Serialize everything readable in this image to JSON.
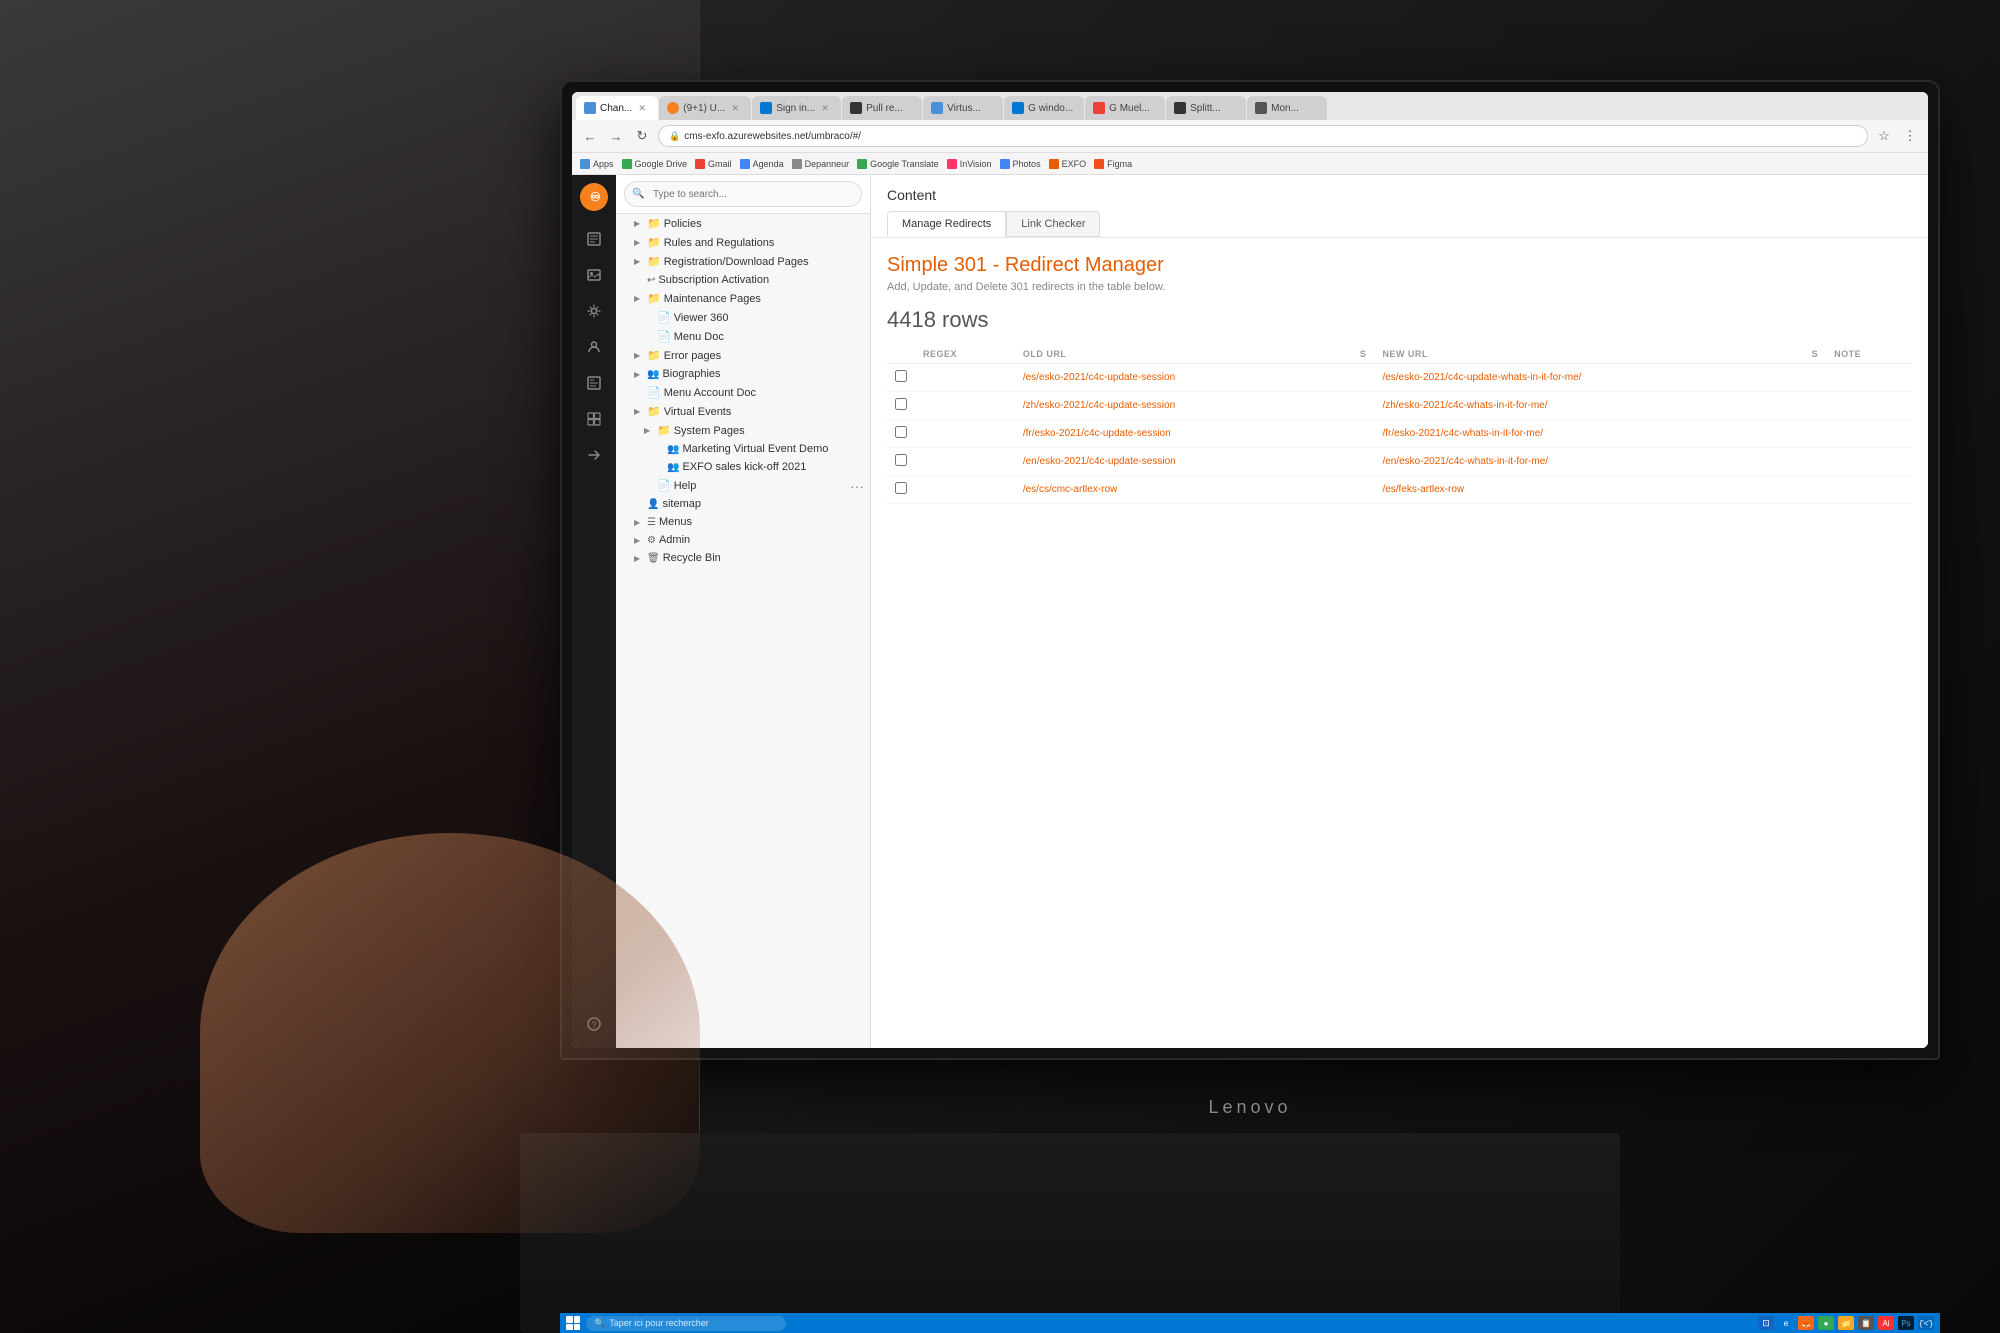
{
  "background": {
    "color": "#1a1a1a"
  },
  "laptop": {
    "brand": "Lenovo"
  },
  "browser": {
    "url": "cms-exfo.azurewebsites.net/umbraco/#/",
    "tabs": [
      {
        "id": 1,
        "label": "Chan...",
        "active": true,
        "favicon_color": "#4a90d9"
      },
      {
        "id": 2,
        "label": "(9+1) U...",
        "active": false,
        "favicon_color": "#f5821f"
      },
      {
        "id": 3,
        "label": "Sign in...",
        "active": false,
        "favicon_color": "#0078d4"
      },
      {
        "id": 4,
        "label": "Pull re...",
        "active": false,
        "favicon_color": "#333"
      },
      {
        "id": 5,
        "label": "Virtus...",
        "active": false,
        "favicon_color": "#4a90d9"
      },
      {
        "id": 6,
        "label": "windo...",
        "active": false,
        "favicon_color": "#0078d4"
      },
      {
        "id": 7,
        "label": "G Muel...",
        "active": false,
        "favicon_color": "#e44"
      },
      {
        "id": 8,
        "label": "Splitt...",
        "active": false,
        "favicon_color": "#333"
      }
    ],
    "bookmarks": [
      {
        "label": "Apps",
        "favicon_color": "#4a90d9"
      },
      {
        "label": "Google Drive",
        "favicon_color": "#34a853"
      },
      {
        "label": "Gmail",
        "favicon_color": "#ea4335"
      },
      {
        "label": "Agenda",
        "favicon_color": "#4285f4"
      },
      {
        "label": "Depanneur",
        "favicon_color": "#888"
      },
      {
        "label": "Google Translate",
        "favicon_color": "#34a853"
      },
      {
        "label": "InVision",
        "favicon_color": "#ff3366"
      },
      {
        "label": "Photos",
        "favicon_color": "#4285f4"
      },
      {
        "label": "EXFO",
        "favicon_color": "#e65c00"
      },
      {
        "label": "Figma",
        "favicon_color": "#f24e1e"
      }
    ]
  },
  "umbraco": {
    "sidebar_icons": [
      {
        "name": "content-icon",
        "symbol": "📄"
      },
      {
        "name": "media-icon",
        "symbol": "🖼"
      },
      {
        "name": "settings-icon",
        "symbol": "⚙"
      },
      {
        "name": "users-icon",
        "symbol": "👤"
      },
      {
        "name": "forms-icon",
        "symbol": "☰"
      },
      {
        "name": "packages-icon",
        "symbol": "▦"
      },
      {
        "name": "deploy-icon",
        "symbol": "→"
      },
      {
        "name": "help-icon",
        "symbol": "?"
      }
    ]
  },
  "tree": {
    "search_placeholder": "Type to search...",
    "items": [
      {
        "id": "policies",
        "label": "Policies",
        "indent": 1,
        "has_toggle": true,
        "icon": "📁"
      },
      {
        "id": "rules",
        "label": "Rules and Regulations",
        "indent": 1,
        "has_toggle": true,
        "icon": "📁"
      },
      {
        "id": "registration",
        "label": "Registration/Download Pages",
        "indent": 1,
        "has_toggle": true,
        "icon": "📁"
      },
      {
        "id": "subscription",
        "label": "Subscription Activation",
        "indent": 1,
        "has_toggle": false,
        "icon": "↩"
      },
      {
        "id": "maintenance",
        "label": "Maintenance Pages",
        "indent": 1,
        "has_toggle": true,
        "icon": "📁"
      },
      {
        "id": "viewer360",
        "label": "Viewer 360",
        "indent": 2,
        "has_toggle": false,
        "icon": "📄"
      },
      {
        "id": "menudoc",
        "label": "Menu Doc",
        "indent": 2,
        "has_toggle": false,
        "icon": "📄"
      },
      {
        "id": "errorpages",
        "label": "Error pages",
        "indent": 1,
        "has_toggle": true,
        "icon": "📁"
      },
      {
        "id": "biographies",
        "label": "Biographies",
        "indent": 1,
        "has_toggle": true,
        "icon": "👥"
      },
      {
        "id": "menuaccountdoc",
        "label": "Menu Account Doc",
        "indent": 1,
        "has_toggle": false,
        "icon": "📄"
      },
      {
        "id": "virtualevents",
        "label": "Virtual Events",
        "indent": 1,
        "has_toggle": true,
        "icon": "📁"
      },
      {
        "id": "systempages",
        "label": "System Pages",
        "indent": 2,
        "has_toggle": true,
        "icon": "📁"
      },
      {
        "id": "marketingvirtual",
        "label": "Marketing Virtual Event Demo",
        "indent": 3,
        "has_toggle": false,
        "icon": "👥"
      },
      {
        "id": "exfosales",
        "label": "EXFO sales kick-off 2021",
        "indent": 3,
        "has_toggle": false,
        "icon": "👥"
      },
      {
        "id": "help",
        "label": "Help",
        "indent": 2,
        "has_toggle": false,
        "icon": "📄"
      },
      {
        "id": "sitemap",
        "label": "sitemap",
        "indent": 1,
        "has_toggle": false,
        "icon": "👤",
        "has_more": true
      },
      {
        "id": "menus",
        "label": "Menus",
        "indent": 1,
        "has_toggle": true,
        "icon": "☰"
      },
      {
        "id": "admin",
        "label": "Admin",
        "indent": 1,
        "has_toggle": true,
        "icon": "⚙"
      },
      {
        "id": "recycle",
        "label": "Recycle Bin",
        "indent": 1,
        "has_toggle": true,
        "icon": "🗑"
      }
    ]
  },
  "content": {
    "title": "Content",
    "tabs": [
      {
        "id": "manage-redirects",
        "label": "Manage Redirects",
        "active": true
      },
      {
        "id": "link-checker",
        "label": "Link Checker",
        "active": false
      }
    ],
    "redirect_manager": {
      "title": "Simple 301 - Redirect Manager",
      "subtitle": "Add, Update, and Delete 301 redirects in the table below.",
      "rows_count": "4418 rows",
      "table_headers": [
        {
          "id": "regex",
          "label": "REGEX"
        },
        {
          "id": "old_url",
          "label": "OLD URL"
        },
        {
          "id": "s1",
          "label": "S"
        },
        {
          "id": "new_url",
          "label": "NEW URL"
        },
        {
          "id": "s2",
          "label": "S"
        },
        {
          "id": "notes",
          "label": "NOTE"
        }
      ],
      "rows": [
        {
          "checkbox": false,
          "old_url": "/es/esko-2021/c4c-update-session",
          "new_url": "/es/esko-2021/c4c-update-whats-in-it-for-me/"
        },
        {
          "checkbox": false,
          "old_url": "/zh/esko-2021/c4c-update-session",
          "new_url": "/zh/esko-2021/c4c-whats-in-it-for-me/"
        },
        {
          "checkbox": false,
          "old_url": "/fr/esko-2021/c4c-update-session",
          "new_url": "/fr/esko-2021/c4c-whats-in-it-for-me/"
        },
        {
          "checkbox": false,
          "old_url": "/en/esko-2021/c4c-update-session",
          "new_url": "/en/esko-2021/c4c-whats-in-it-for-me/"
        },
        {
          "checkbox": false,
          "old_url": "/es/cs/cmc-artlex-row",
          "new_url": "/es/feks-artlex-row"
        }
      ]
    }
  },
  "taskbar": {
    "search_placeholder": "Taper ici pour rechercher",
    "icons": [
      "⊞",
      "E",
      "🔥",
      "●",
      "📁",
      "📋",
      "A",
      "Ps"
    ]
  }
}
